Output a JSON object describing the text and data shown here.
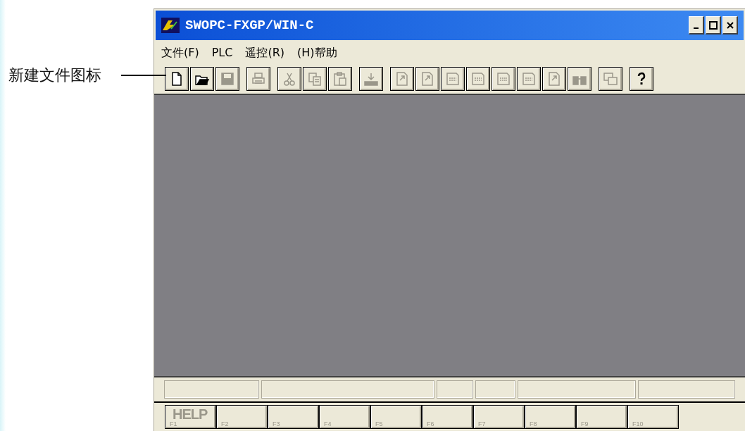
{
  "annotation": {
    "label": "新建文件图标"
  },
  "window": {
    "title": "SWOPC-FXGP/WIN-C"
  },
  "menu": [
    "文件(F)",
    "PLC",
    "遥控(R)",
    "(H)帮助"
  ],
  "toolbar": [
    {
      "items": [
        {
          "kind": "new",
          "disabled": false
        },
        {
          "kind": "open",
          "disabled": false
        },
        {
          "kind": "save",
          "disabled": true
        }
      ]
    },
    {
      "items": [
        {
          "kind": "print",
          "disabled": true
        }
      ]
    },
    {
      "items": [
        {
          "kind": "cut",
          "disabled": true
        },
        {
          "kind": "copy",
          "disabled": true
        },
        {
          "kind": "paste",
          "disabled": true
        }
      ]
    },
    {
      "items": [
        {
          "kind": "transfer",
          "disabled": true
        }
      ]
    },
    {
      "items": [
        {
          "kind": "page",
          "disabled": true
        },
        {
          "kind": "page",
          "disabled": true
        },
        {
          "kind": "tag",
          "disabled": true
        },
        {
          "kind": "tag",
          "disabled": true
        },
        {
          "kind": "tag",
          "disabled": true
        },
        {
          "kind": "tag",
          "disabled": true
        },
        {
          "kind": "page",
          "disabled": true
        },
        {
          "kind": "find",
          "disabled": true
        }
      ]
    },
    {
      "items": [
        {
          "kind": "window",
          "disabled": true
        }
      ]
    },
    {
      "items": [
        {
          "kind": "help",
          "disabled": false
        }
      ]
    }
  ],
  "function_keys": [
    {
      "label": "F1",
      "caption": "HELP",
      "disabled": true
    },
    {
      "label": "F2",
      "disabled": true
    },
    {
      "label": "F3",
      "disabled": true
    },
    {
      "label": "F4",
      "disabled": true
    },
    {
      "label": "F5",
      "disabled": true
    },
    {
      "label": "F6",
      "disabled": true
    },
    {
      "label": "F7",
      "disabled": true
    },
    {
      "label": "F8",
      "disabled": true
    },
    {
      "label": "F9",
      "disabled": true
    },
    {
      "label": "F10",
      "disabled": true
    }
  ]
}
